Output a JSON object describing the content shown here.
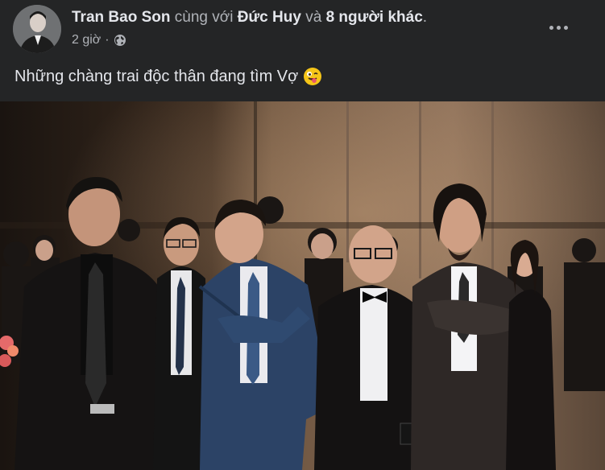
{
  "post": {
    "author": "Tran Bao Son",
    "with_text": "cùng với",
    "tagged": "Đức Huy",
    "and_text": "và",
    "others": "8 người khác",
    "period": ".",
    "time": "2 giờ",
    "separator": "·",
    "privacy_icon": "globe-icon",
    "more_icon": "more-options-icon",
    "caption": "Những chàng trai độc thân đang tìm Vợ",
    "caption_emoji": "winking-tongue-face-emoji"
  },
  "colors": {
    "background": "#242526",
    "text_primary": "#e4e6eb",
    "text_secondary": "#b0b3b8"
  }
}
